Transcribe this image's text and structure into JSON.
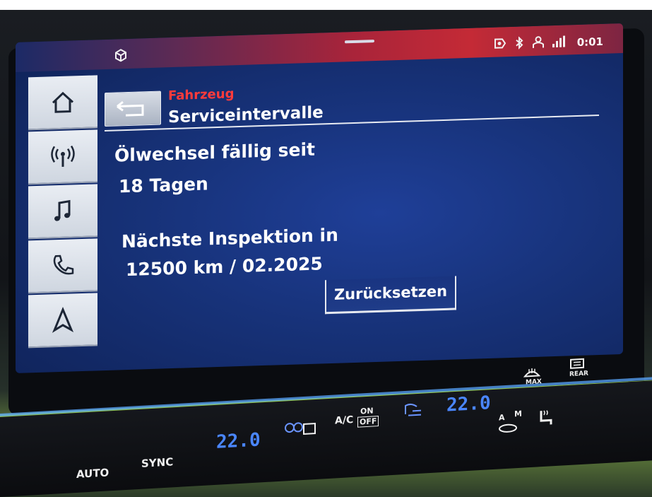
{
  "status_bar": {
    "cube_icon": "3d-box-icon",
    "icons": [
      "parking-sensor-icon",
      "bluetooth-icon",
      "user-profile-icon",
      "signal-icon"
    ],
    "time": "0:01"
  },
  "nav": {
    "items": [
      {
        "name": "home",
        "icon": "home-icon"
      },
      {
        "name": "radio",
        "icon": "radio-antenna-icon"
      },
      {
        "name": "media",
        "icon": "music-note-icon"
      },
      {
        "name": "phone",
        "icon": "phone-icon"
      },
      {
        "name": "navigation",
        "icon": "navigation-arrow-icon"
      }
    ]
  },
  "header": {
    "breadcrumb": "Fahrzeug",
    "title": "Serviceintervalle",
    "back_icon": "back-arrow-icon"
  },
  "content": {
    "oil_label": "Ölwechsel fällig seit",
    "oil_value": "18 Tagen",
    "inspection_label": "Nächste Inspektion in",
    "inspection_value": "12500 km / 02.2025",
    "reset_button": "Zurücksetzen"
  },
  "climate": {
    "auto": "AUTO",
    "sync": "SYNC",
    "temp_left": "22.0",
    "temp_right": "22.0",
    "ac_label": "A/C",
    "ac_on": "ON",
    "ac_off": "OFF",
    "max_label": "MAX",
    "rear_label": "REAR",
    "auto_mode_a": "A",
    "auto_mode_m": "M"
  },
  "colors": {
    "breadcrumb": "#ff3b3b",
    "screen_bg": "#173279",
    "status_bar_red": "#c42a36"
  }
}
